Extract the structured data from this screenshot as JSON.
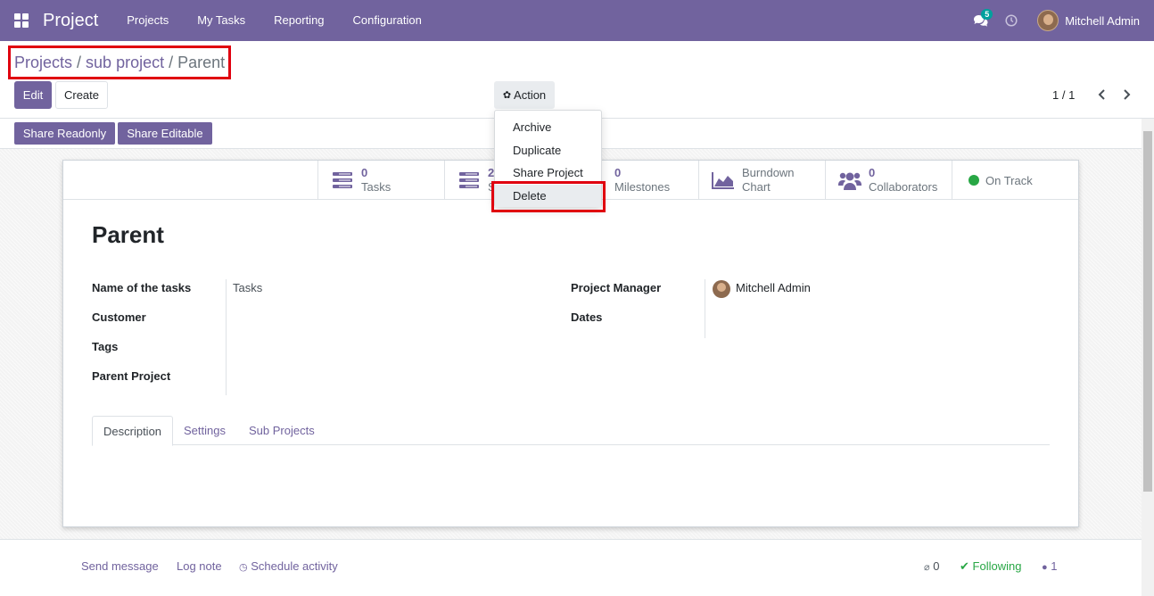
{
  "navbar": {
    "brand": "Project",
    "menu": [
      "Projects",
      "My Tasks",
      "Reporting",
      "Configuration"
    ],
    "chat_count": "5",
    "user_name": "Mitchell Admin"
  },
  "breadcrumb": {
    "items": [
      "Projects",
      "sub project"
    ],
    "separator": "/",
    "current": "Parent"
  },
  "toolbar": {
    "edit_label": "Edit",
    "create_label": "Create",
    "action_label": "Action",
    "pager": "1 / 1"
  },
  "share": {
    "readonly_label": "Share Readonly",
    "editable_label": "Share Editable"
  },
  "action_menu": {
    "items": [
      "Archive",
      "Duplicate",
      "Share Project",
      "Delete"
    ],
    "highlighted": "Delete"
  },
  "stats": {
    "tasks": {
      "count": "0",
      "label": "Tasks"
    },
    "sub": {
      "count": "2",
      "label": "S"
    },
    "milestones": {
      "count": "0",
      "label": "Milestones"
    },
    "burndown": {
      "line1": "Burndown",
      "line2": "Chart"
    },
    "collaborators": {
      "count": "0",
      "label": "Collaborators"
    },
    "status": {
      "label": "On Track",
      "color": "#28a745"
    }
  },
  "record": {
    "title": "Parent",
    "fields_left": [
      {
        "label": "Name of the tasks",
        "value": "Tasks"
      },
      {
        "label": "Customer",
        "value": ""
      },
      {
        "label": "Tags",
        "value": ""
      },
      {
        "label": "Parent Project",
        "value": ""
      }
    ],
    "fields_right": [
      {
        "label": "Project Manager",
        "value": "Mitchell Admin"
      },
      {
        "label": "Dates",
        "value": ""
      }
    ]
  },
  "tabs": [
    "Description",
    "Settings",
    "Sub Projects"
  ],
  "chatter": {
    "send_message": "Send message",
    "log_note": "Log note",
    "schedule_activity": "Schedule activity",
    "attachments": "0",
    "following": "Following",
    "followers": "1"
  },
  "colors": {
    "brand": "#71639e",
    "highlight": "#e0000f",
    "success": "#28a745"
  }
}
